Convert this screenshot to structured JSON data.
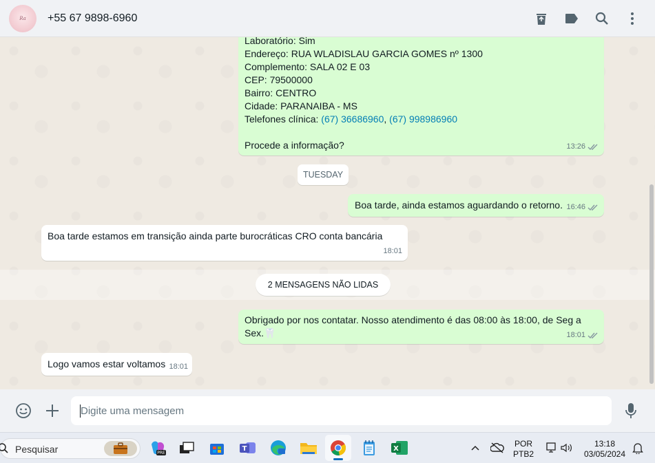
{
  "header": {
    "contact_name": "+55 67 9898-6960",
    "avatar_text": "Ra",
    "icons": [
      "archive-icon",
      "label-icon",
      "search-icon",
      "menu-icon"
    ]
  },
  "messages": {
    "m1": {
      "lines": [
        "Laboratório: Sim",
        "Endereço: RUA WLADISLAU GARCIA GOMES nº 1300",
        "Complemento: SALA 02 E 03",
        "CEP: 79500000",
        "Bairro: CENTRO",
        "Cidade: PARANAIBA - MS"
      ],
      "phone_label": "Telefones clínica: ",
      "phone1": "(67) 36686960",
      "phone_sep": ", ",
      "phone2": "(67) 998986960",
      "last": "Procede a informação?",
      "time": "13:26"
    },
    "day_label": "TUESDAY",
    "m2": {
      "text": "Boa tarde, ainda estamos aguardando o retorno.",
      "time": "16:46"
    },
    "m3": {
      "text": "Boa tarde estamos em transição ainda parte burocráticas CRO conta bancária",
      "time": "18:01"
    },
    "unread_label": "2 MENSAGENS NÃO LIDAS",
    "m4": {
      "text": "Obrigado por nos contatar. Nosso atendimento é das 08:00 às 18:00, de Seg a Sex.🦷",
      "time": "18:01"
    },
    "m5": {
      "text": "Logo vamos estar voltamos",
      "time": "18:01"
    }
  },
  "composer": {
    "placeholder": "Digite uma mensagem"
  },
  "taskbar": {
    "search_label": "Pesquisar",
    "lang_top": "POR",
    "lang_bottom": "PTB2",
    "clock_time": "13:18",
    "clock_date": "03/05/2024"
  },
  "colors": {
    "outgoing": "#d9fdd3",
    "incoming": "#ffffff",
    "ticks": "#8696a0",
    "link": "#027eb5"
  }
}
